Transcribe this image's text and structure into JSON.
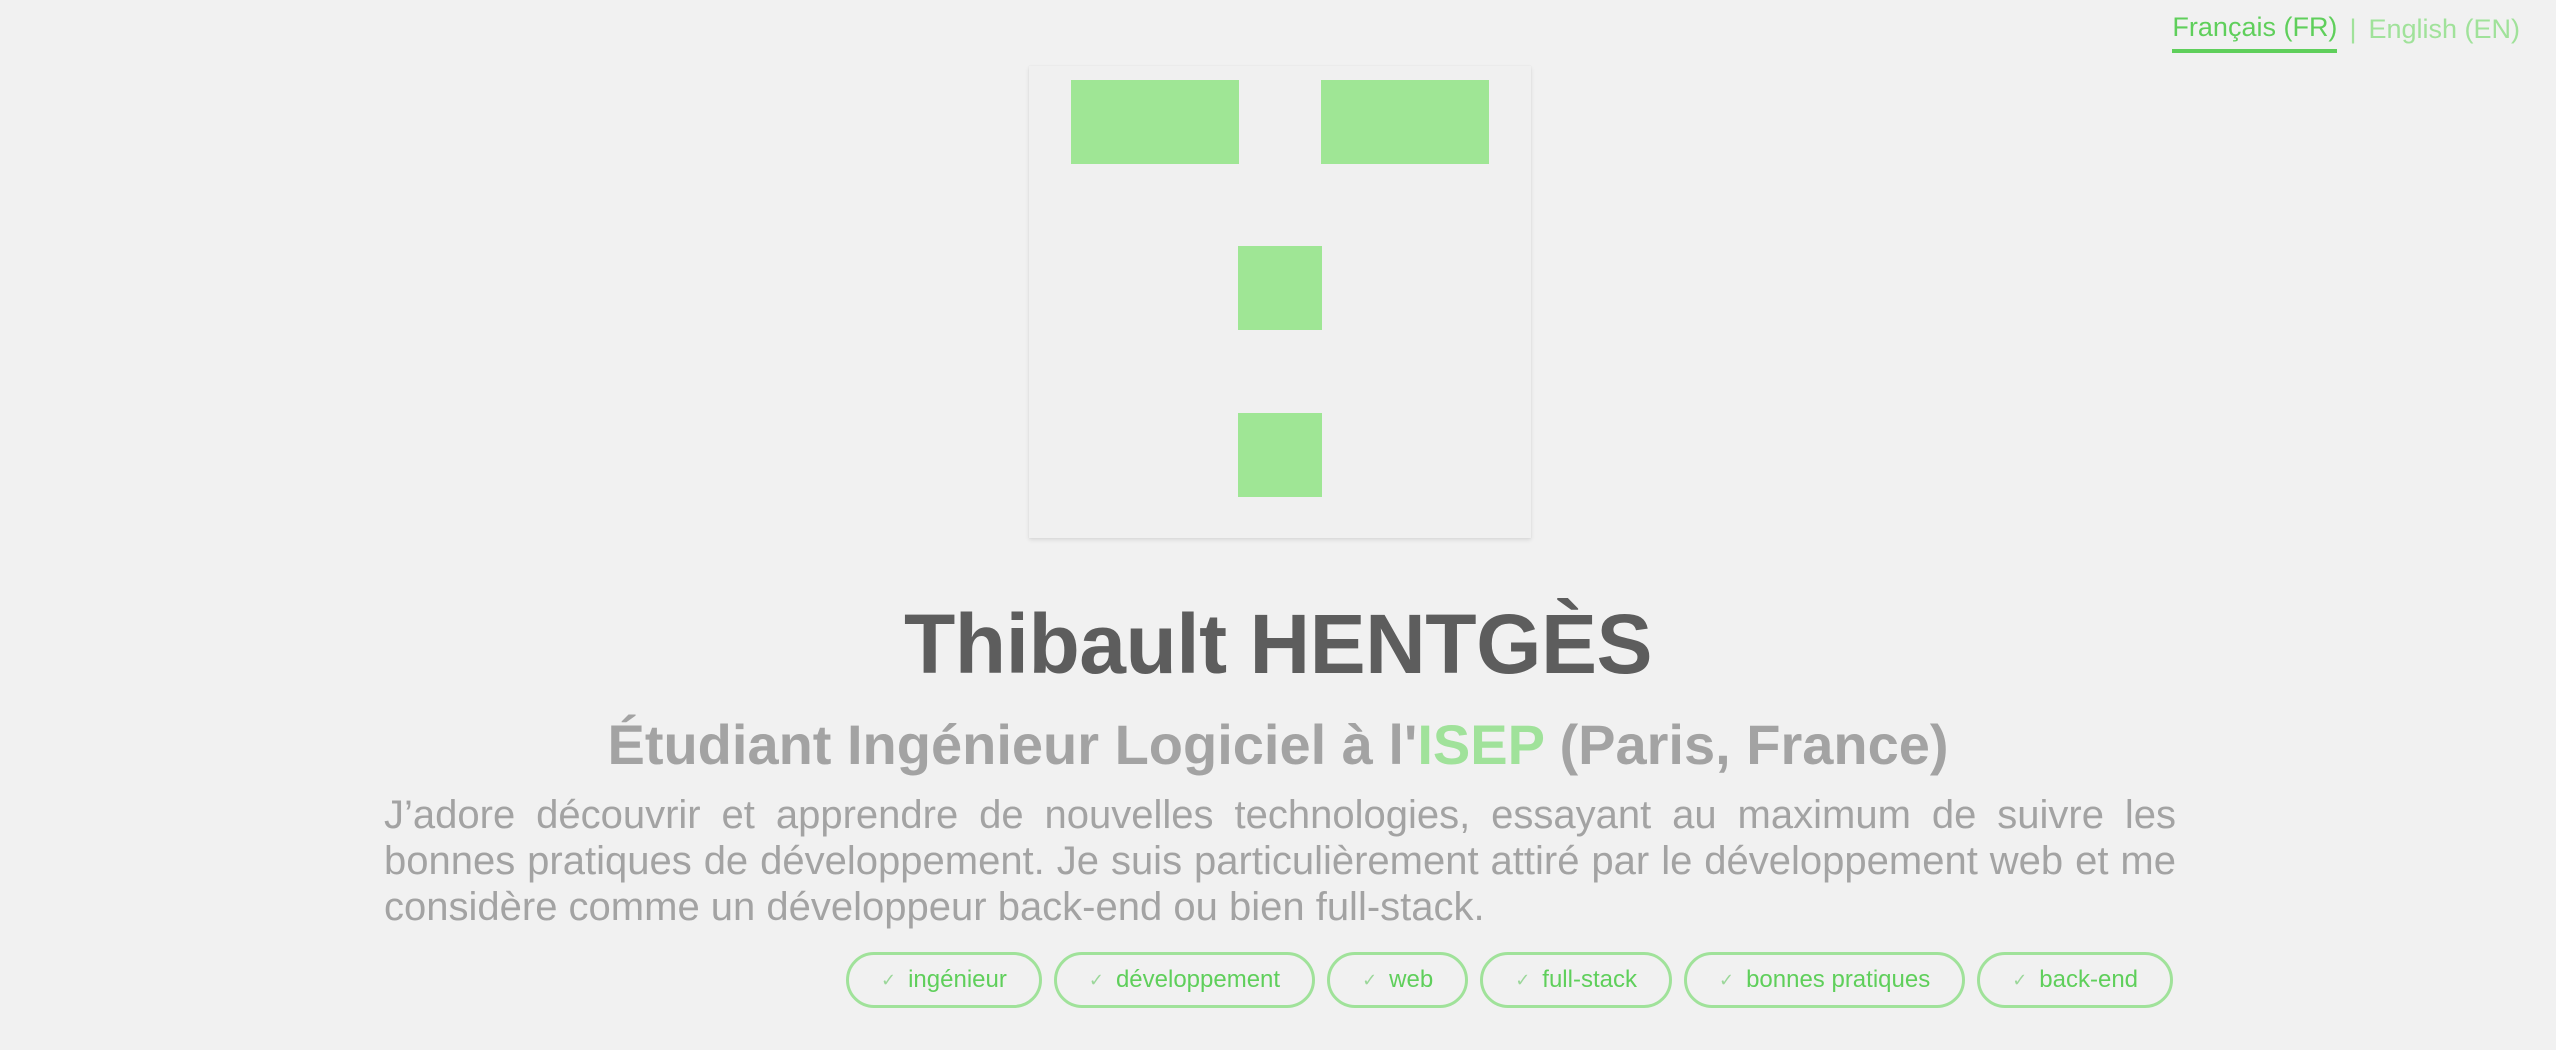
{
  "languages": {
    "fr": "Français (FR)",
    "separator": "|",
    "en": "English (EN)"
  },
  "profile": {
    "name": "Thibault HENTGÈS",
    "subtitle_prefix": "Étudiant Ingénieur Logiciel à l'",
    "subtitle_accent": "ISEP",
    "subtitle_suffix": " (Paris, France)",
    "bio": "J’adore découvrir et apprendre de nouvelles technologies, essayant au maximum de suivre les bonnes pratiques de développement. Je suis particulièrement attiré par le développement web et me considère comme un développeur back-end ou bien full-stack."
  },
  "tags": [
    "ingénieur",
    "développement",
    "web",
    "full-stack",
    "bonnes pratiques",
    "back-end"
  ],
  "icons": {
    "tag": "check-icon",
    "avatar": "identicon-logo"
  },
  "colors": {
    "accent": "#5fcf5b",
    "accent_light": "#a0e29a",
    "text_dark": "#5d5d5d",
    "text_muted": "#a3a3a3",
    "background": "#f1f1f1"
  }
}
